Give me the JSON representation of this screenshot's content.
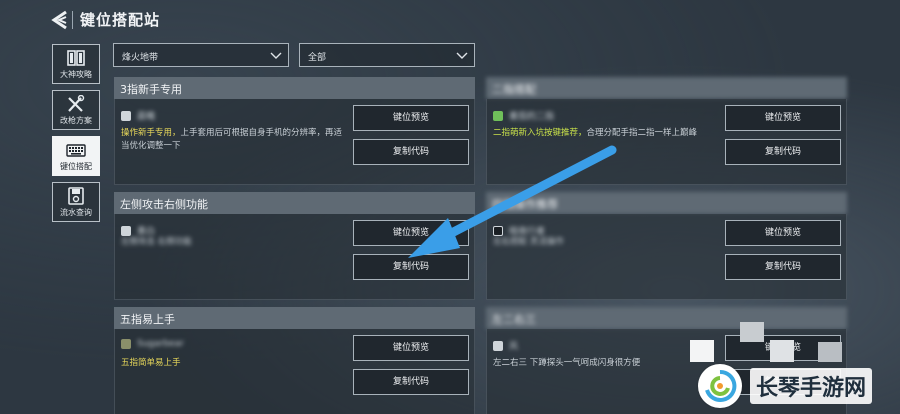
{
  "header": {
    "title": "键位搭配站"
  },
  "sidebar": {
    "items": [
      {
        "label": "大神攻略",
        "icon": "book-icon",
        "active": false
      },
      {
        "label": "改枪方案",
        "icon": "wrench-icon",
        "active": false
      },
      {
        "label": "键位搭配",
        "icon": "keyboard-icon",
        "active": true
      },
      {
        "label": "流水查询",
        "icon": "floppy-icon",
        "active": false
      }
    ]
  },
  "filters": {
    "map": "烽火地带",
    "category": "全部"
  },
  "buttons": {
    "preview": "键位预览",
    "copy": "复制代码"
  },
  "cards": [
    {
      "title": "3指新手专用",
      "author": "晨曦",
      "desc_hl": "操作新手专用，",
      "desc": "上手套用后可根据自身手机的分辨率，再适当优化调整一下"
    },
    {
      "title": "二指搭配",
      "author": "番茄的二指",
      "desc_hl": "二指萌新入坑按键推荐，",
      "desc": "合理分配手指二指一样上巅峰"
    },
    {
      "title": "左侧攻击右侧功能",
      "author": "墨白",
      "desc_hl": "",
      "desc": "左侧攻击 右侧功能"
    },
    {
      "title": "四指操作推荐",
      "author": "暗夜行者",
      "desc_hl": "",
      "desc": "左右搭配 灵活操作"
    },
    {
      "title": "五指易上手",
      "author": "Sugarbear",
      "desc_hl": "五指简单易上手",
      "desc": ""
    },
    {
      "title": "左二右三",
      "author": "风",
      "desc_hl": "",
      "desc": "左二右三 下蹲探头一气呵成闪身很方便"
    }
  ],
  "watermark": {
    "text": "长琴手游网"
  },
  "colors": {
    "accent_arrow": "#3a9ee8",
    "card_header": "#5f6a74",
    "highlight": "#e8d85a"
  }
}
